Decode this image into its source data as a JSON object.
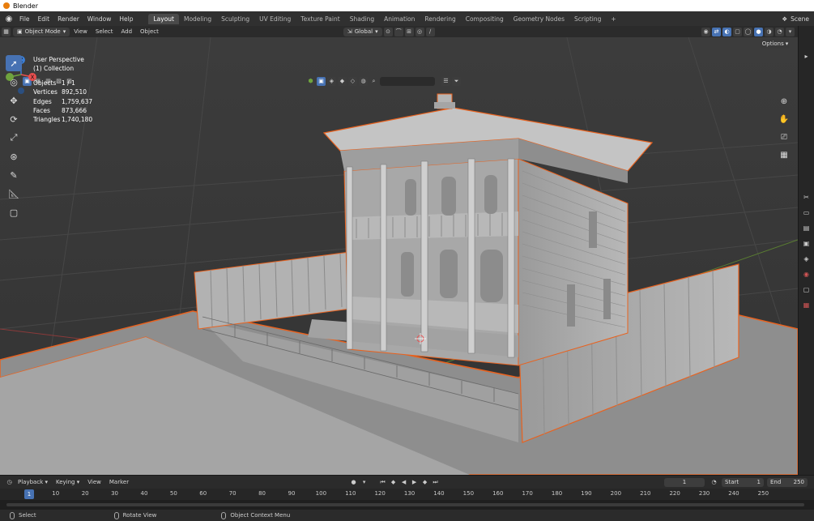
{
  "window": {
    "title": "Blender"
  },
  "menu": [
    "File",
    "Edit",
    "Render",
    "Window",
    "Help"
  ],
  "workspaces": [
    {
      "label": "Layout",
      "active": true
    },
    {
      "label": "Modeling"
    },
    {
      "label": "Sculpting"
    },
    {
      "label": "UV Editing"
    },
    {
      "label": "Texture Paint"
    },
    {
      "label": "Shading"
    },
    {
      "label": "Animation"
    },
    {
      "label": "Rendering"
    },
    {
      "label": "Compositing"
    },
    {
      "label": "Geometry Nodes"
    },
    {
      "label": "Scripting"
    }
  ],
  "scene_label": "Scene",
  "header": {
    "mode": "Object Mode",
    "menus": [
      "View",
      "Select",
      "Add",
      "Object"
    ],
    "transform_orientation": "Global",
    "options": "Options"
  },
  "viewport": {
    "perspective": "User Perspective",
    "collection": "(1) Collection",
    "stats": [
      {
        "label": "Objects",
        "value": "1 / 1"
      },
      {
        "label": "Vertices",
        "value": "892,510"
      },
      {
        "label": "Edges",
        "value": "1,759,637"
      },
      {
        "label": "Faces",
        "value": "873,666"
      },
      {
        "label": "Triangles",
        "value": "1,740,180"
      }
    ],
    "gizmo": {
      "z": "Z",
      "x": "X",
      "y": "Y"
    }
  },
  "timeline": {
    "menus": [
      "Playback",
      "Keying",
      "View",
      "Marker"
    ],
    "current_frame": "1",
    "start_label": "Start",
    "start": "1",
    "end_label": "End",
    "end": "250",
    "ticks": [
      "10",
      "20",
      "30",
      "40",
      "50",
      "60",
      "70",
      "80",
      "90",
      "100",
      "110",
      "120",
      "130",
      "140",
      "150",
      "160",
      "170",
      "180",
      "190",
      "200",
      "210",
      "220",
      "230",
      "240",
      "250"
    ]
  },
  "statusbar": {
    "select": "Select",
    "rotate": "Rotate View",
    "context": "Object Context Menu"
  },
  "colors": {
    "accent": "#4772b3",
    "outline": "#e8621f",
    "axis_x": "#e94f4f",
    "axis_y": "#6fa33e",
    "axis_z": "#3b7fd6"
  }
}
